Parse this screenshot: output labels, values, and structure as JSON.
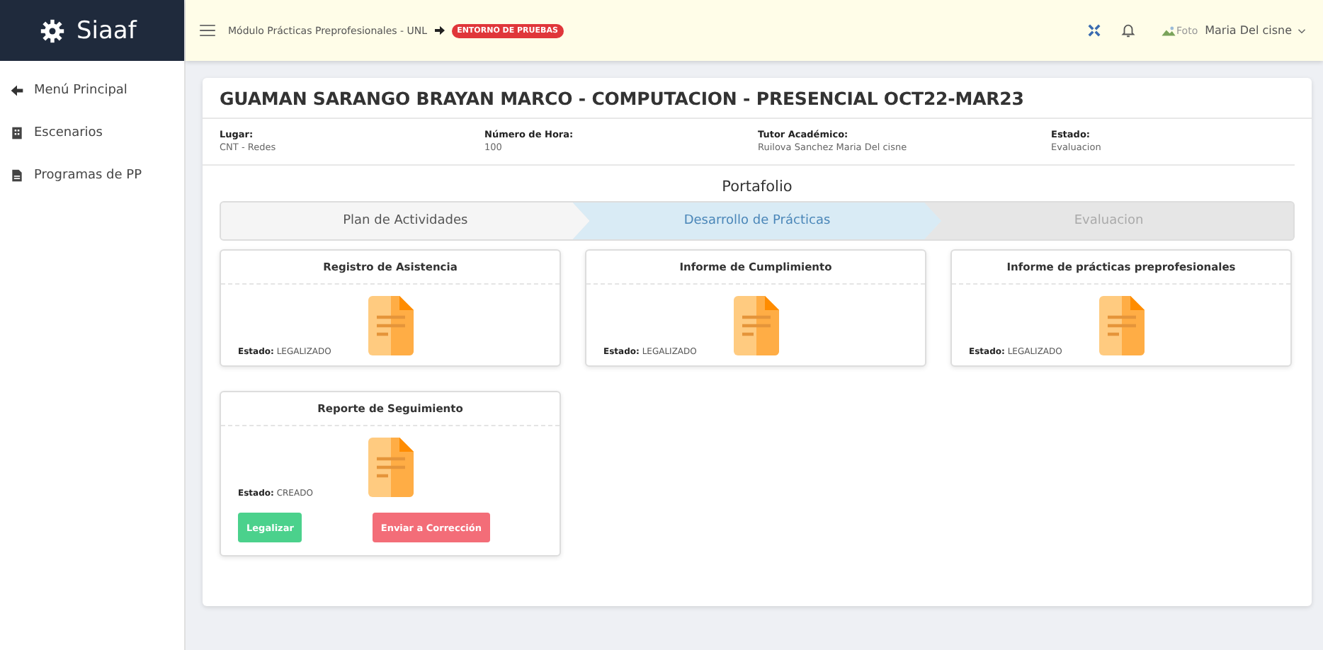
{
  "brand": {
    "name": "Siaaf"
  },
  "topbar": {
    "breadcrumb": "Módulo Prácticas Preprofesionales - UNL",
    "badge": "ENTORNO DE PRUEBAS",
    "avatar_alt": "Foto",
    "user": "Maria Del cisne"
  },
  "sidebar": {
    "items": [
      {
        "label": "Menú Principal",
        "kind": "back"
      },
      {
        "label": "Escenarios",
        "kind": "building"
      },
      {
        "label": "Programas de PP",
        "kind": "file"
      }
    ]
  },
  "header": {
    "title": "GUAMAN SARANGO BRAYAN MARCO - COMPUTACION - PRESENCIAL OCT22-MAR23",
    "fields": [
      {
        "label": "Lugar:",
        "value": "CNT - Redes"
      },
      {
        "label": "Número de Hora:",
        "value": "100"
      },
      {
        "label": "Tutor Académico:",
        "value": "Ruilova Sanchez Maria Del cisne"
      },
      {
        "label": "Estado:",
        "value": "Evaluacion"
      }
    ]
  },
  "portfolio": {
    "title": "Portafolio",
    "steps": [
      {
        "label": "Plan de Actividades",
        "completed": true,
        "selected": false
      },
      {
        "label": "Desarrollo de Prácticas",
        "completed": false,
        "selected": true
      },
      {
        "label": "Evaluacion",
        "completed": false,
        "selected": false
      }
    ],
    "cards": [
      {
        "title": "Registro de Asistencia",
        "status_label": "Estado:",
        "status": "LEGALIZADO"
      },
      {
        "title": "Informe de Cumplimiento",
        "status_label": "Estado:",
        "status": "LEGALIZADO"
      },
      {
        "title": "Informe de prácticas preprofesionales",
        "status_label": "Estado:",
        "status": "LEGALIZADO"
      },
      {
        "title": "Reporte de Seguimiento",
        "status_label": "Estado:",
        "status": "CREADO",
        "buttons": [
          {
            "label": "Legalizar",
            "kind": "success"
          },
          {
            "label": "Enviar a Corrección",
            "kind": "danger"
          }
        ]
      }
    ]
  }
}
